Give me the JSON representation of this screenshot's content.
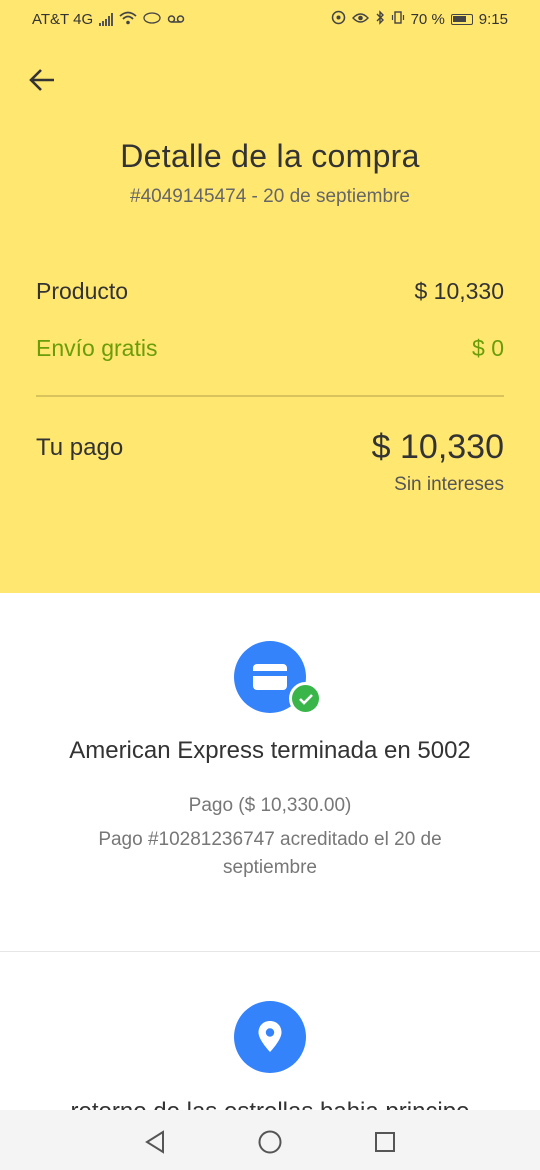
{
  "status_bar": {
    "carrier": "AT&T 4G",
    "battery": "70 %",
    "time": "9:15"
  },
  "header": {
    "title": "Detalle de la compra",
    "subtitle": "#4049145474 - 20 de septiembre",
    "background_color": "#ffe770"
  },
  "summary": {
    "product_label": "Producto",
    "product_value": "$ 10,330",
    "shipping_label": "Envío gratis",
    "shipping_value": "$ 0",
    "shipping_color": "#6b9c09",
    "total_label": "Tu pago",
    "total_value": "$ 10,330",
    "interest_note": "Sin intereses"
  },
  "payment": {
    "icon": "credit-card-icon",
    "status_icon": "check-icon",
    "card_title": "American Express terminada en 5002",
    "amount_line": "Pago ($ 10,330.00)",
    "detail_line": "Pago #10281236747 acreditado el 20 de septiembre",
    "accent_color": "#3483fa",
    "success_color": "#39b54a"
  },
  "shipping_address": {
    "icon": "location-pin-icon",
    "address_line": "retorno de las estrellas bahia principe"
  },
  "nav": {
    "back": "back-triangle-icon",
    "home": "home-circle-icon",
    "recents": "recents-square-icon"
  }
}
